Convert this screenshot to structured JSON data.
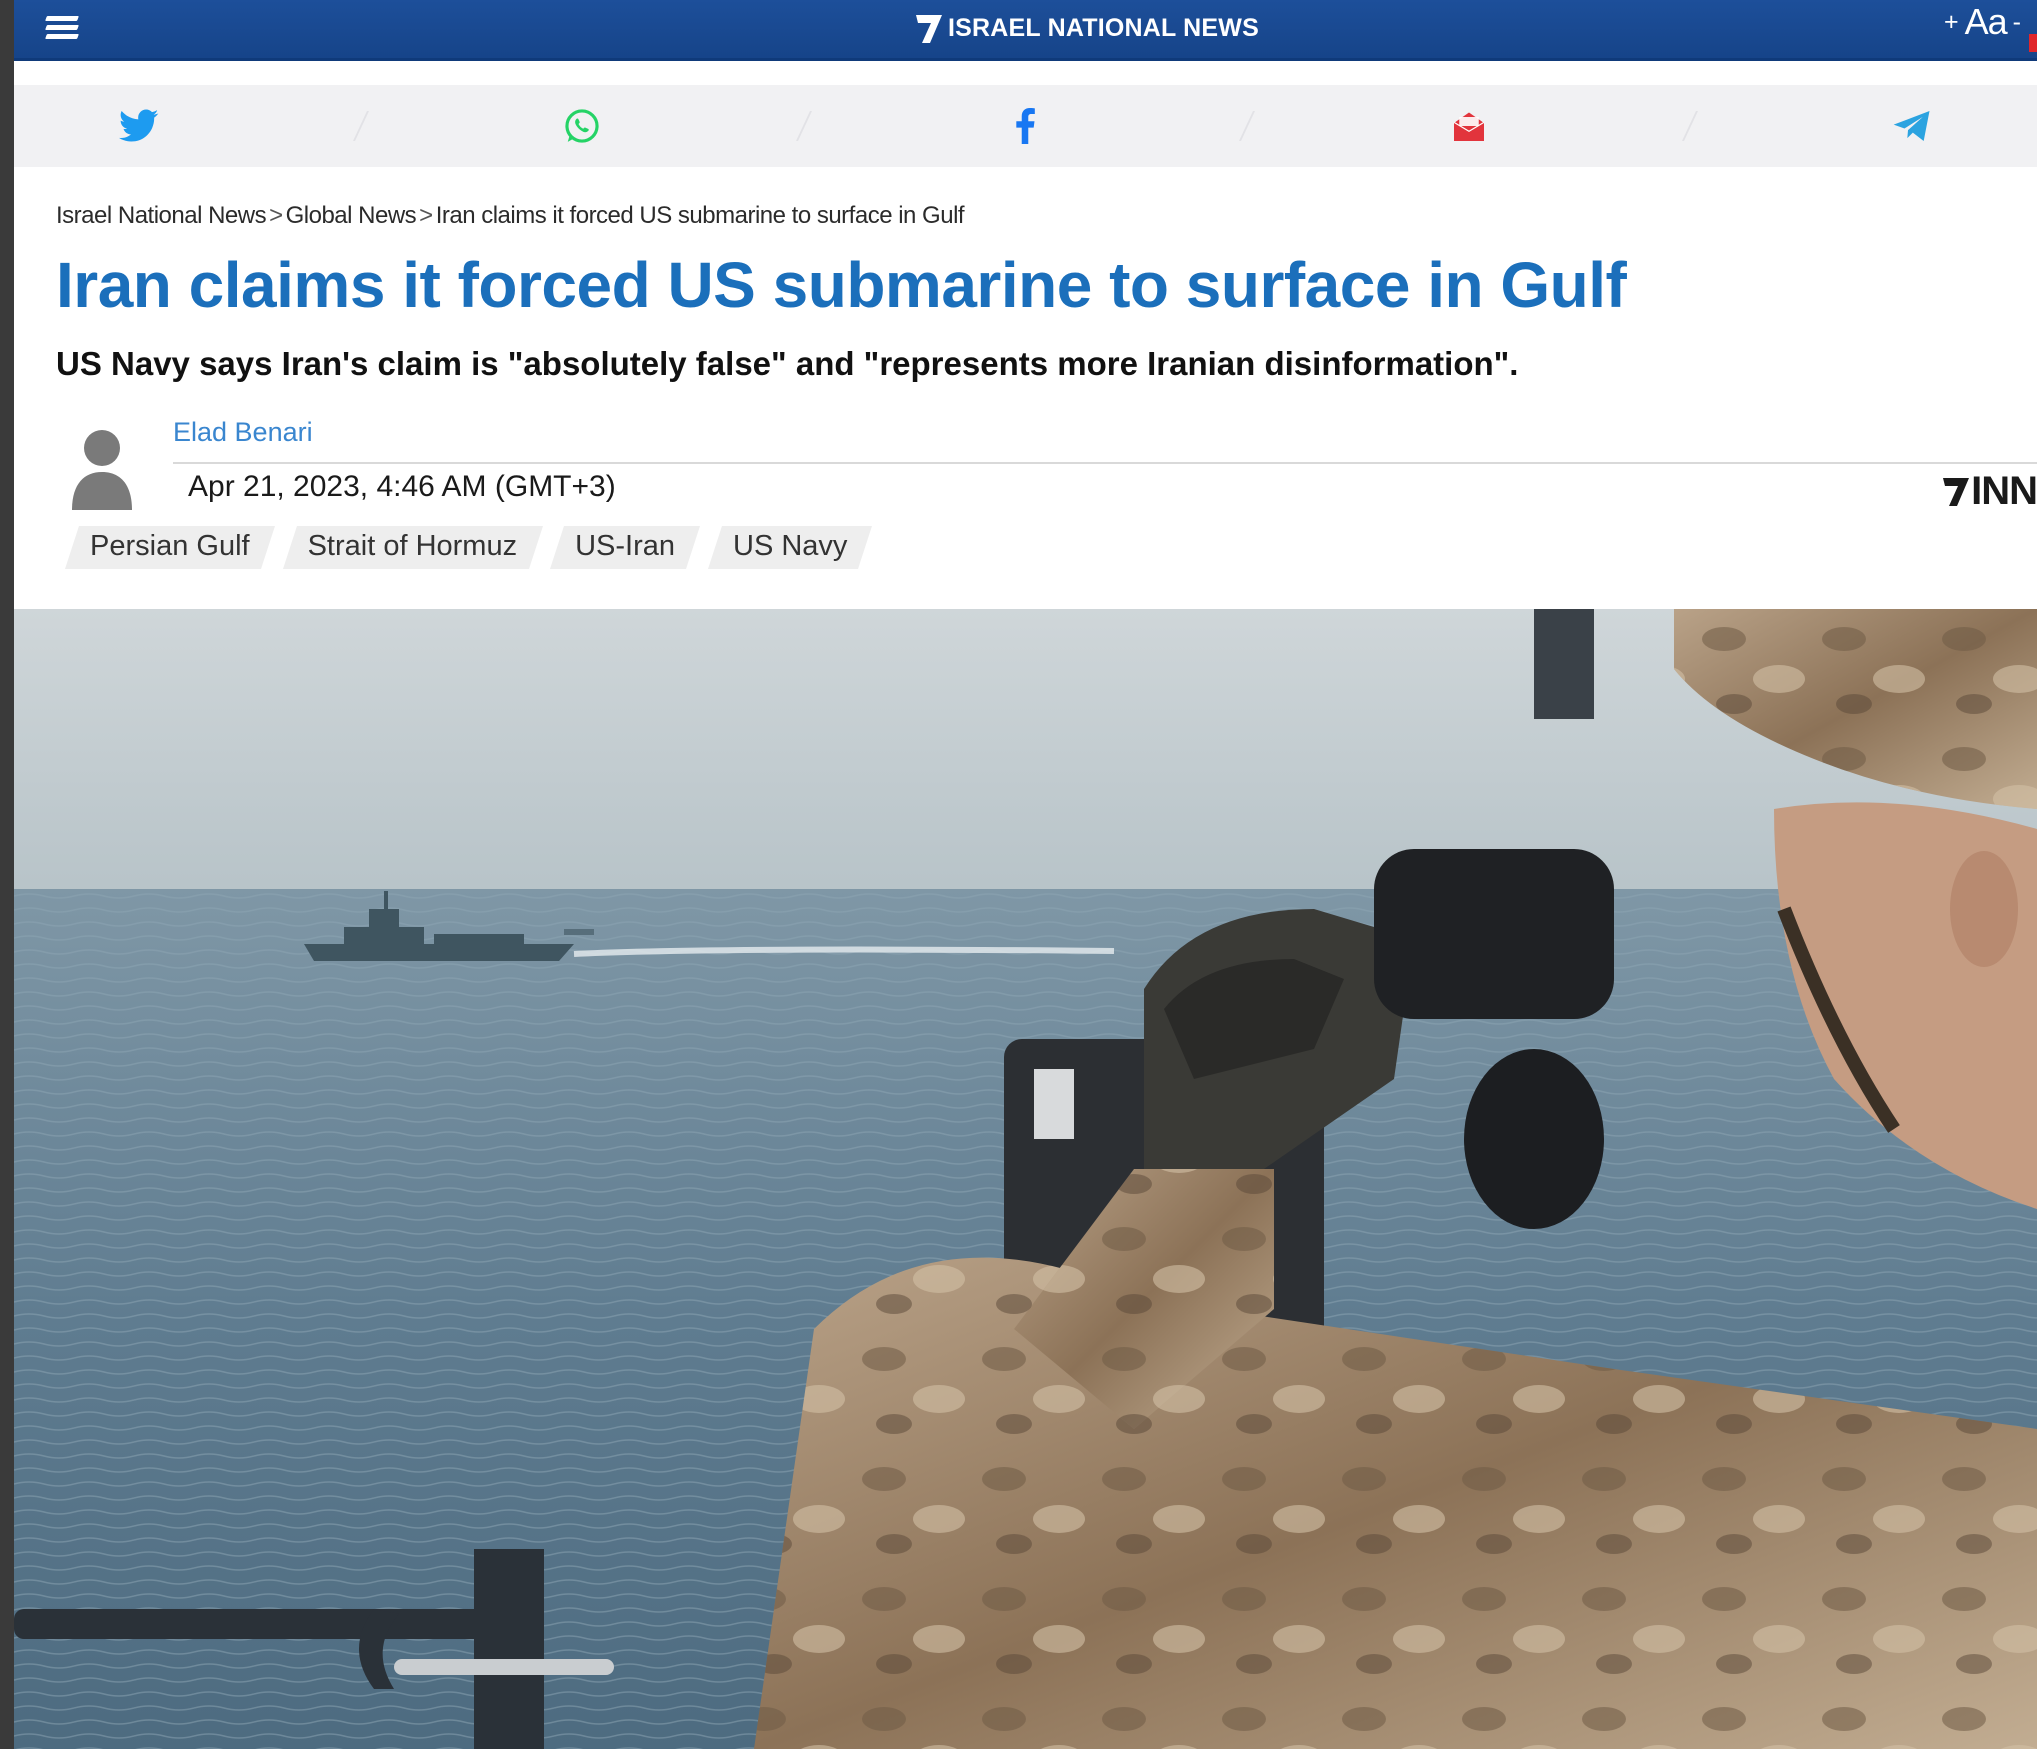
{
  "header": {
    "brand": "ISRAEL NATIONAL NEWS",
    "font_increase": "+",
    "font_label": "Aa",
    "font_decrease": "-",
    "bar_color": "#1a4a94"
  },
  "share": {
    "twitter_icon": "twitter-icon",
    "whatsapp_icon": "whatsapp-icon",
    "facebook_icon": "facebook-icon",
    "email_icon": "email-icon",
    "telegram_icon": "telegram-icon"
  },
  "breadcrumb": {
    "items": [
      "Israel National News",
      "Global News",
      "Iran claims it forced US submarine to surface in Gulf"
    ],
    "separator": ">"
  },
  "article": {
    "title": "Iran claims it forced US submarine to surface in Gulf",
    "subtitle": "US Navy says Iran's claim is \"absolutely false\" and \"represents more Iranian disinformation\".",
    "author": "Elad Benari",
    "date": "Apr 21, 2023, 4:46 AM (GMT+3)",
    "publisher_logo": "INN",
    "tags": [
      "Persian Gulf",
      "Strait of Hormuz",
      "US-Iran",
      "US Navy"
    ],
    "title_color": "#1b6fbb",
    "hero_image": "Sailor in camouflage looking through binoculars at a ship on the sea"
  }
}
